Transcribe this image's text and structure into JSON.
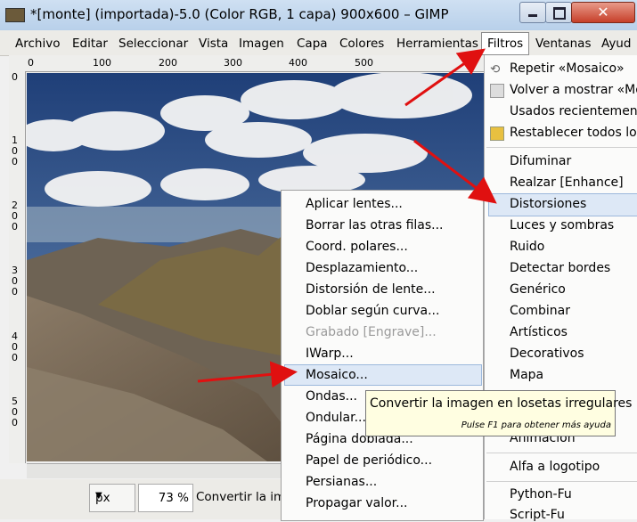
{
  "window": {
    "title": "*[monte] (importada)-5.0 (Color RGB, 1 capa) 900x600 – GIMP",
    "close_glyph": "✕"
  },
  "menubar": {
    "items": [
      "Archivo",
      "Editar",
      "Seleccionar",
      "Vista",
      "Imagen",
      "Capa",
      "Colores",
      "Herramientas",
      "Filtros",
      "Ventanas",
      "Ayud"
    ]
  },
  "rulers": {
    "top_ticks": [
      "0",
      "100",
      "200",
      "300",
      "400",
      "500"
    ],
    "left_ticks": [
      "0",
      "100",
      "200",
      "300",
      "400",
      "500"
    ]
  },
  "statusbar": {
    "unit": "px",
    "zoom": "73 %",
    "text": "Convertir la im"
  },
  "filters_menu": {
    "items": [
      {
        "label": "Repetir «Mosaico»",
        "icon": "repeat-icon"
      },
      {
        "label": "Volver a mostrar «Mos",
        "icon": "reshow-icon"
      },
      {
        "label": "Usados recientemente",
        "icon": ""
      },
      {
        "label": "Restablecer todos los",
        "icon": "reset-icon"
      },
      {
        "label": "Difuminar"
      },
      {
        "label": "Realzar [Enhance]"
      },
      {
        "label": "Distorsiones"
      },
      {
        "label": "Luces y sombras"
      },
      {
        "label": "Ruido"
      },
      {
        "label": "Detectar bordes"
      },
      {
        "label": "Genérico"
      },
      {
        "label": "Combinar"
      },
      {
        "label": "Artísticos"
      },
      {
        "label": "Decorativos"
      },
      {
        "label": "Mapa"
      },
      {
        "label": "Animación"
      },
      {
        "label": "Alfa a logotipo"
      },
      {
        "label": "Python-Fu"
      },
      {
        "label": "Script-Fu"
      }
    ]
  },
  "distortions_menu": {
    "items": [
      {
        "label": "Aplicar lentes..."
      },
      {
        "label": "Borrar las otras filas..."
      },
      {
        "label": "Coord. polares..."
      },
      {
        "label": "Desplazamiento..."
      },
      {
        "label": "Distorsión de lente..."
      },
      {
        "label": "Doblar según curva..."
      },
      {
        "label": "Grabado [Engrave]...",
        "disabled": true
      },
      {
        "label": "IWarp..."
      },
      {
        "label": "Mosaico..."
      },
      {
        "label": "Ondas..."
      },
      {
        "label": "Ondular..."
      },
      {
        "label": "Página doblada..."
      },
      {
        "label": "Papel de periódico..."
      },
      {
        "label": "Persianas..."
      },
      {
        "label": "Propagar valor..."
      }
    ]
  },
  "tooltip": {
    "text": "Convertir la imagen en losetas irregulares",
    "hint": "Pulse F1 para obtener más ayuda"
  },
  "colors": {
    "highlight": "#dde8f6",
    "arrow": "#e01010",
    "tooltip_bg": "#fffee1"
  }
}
